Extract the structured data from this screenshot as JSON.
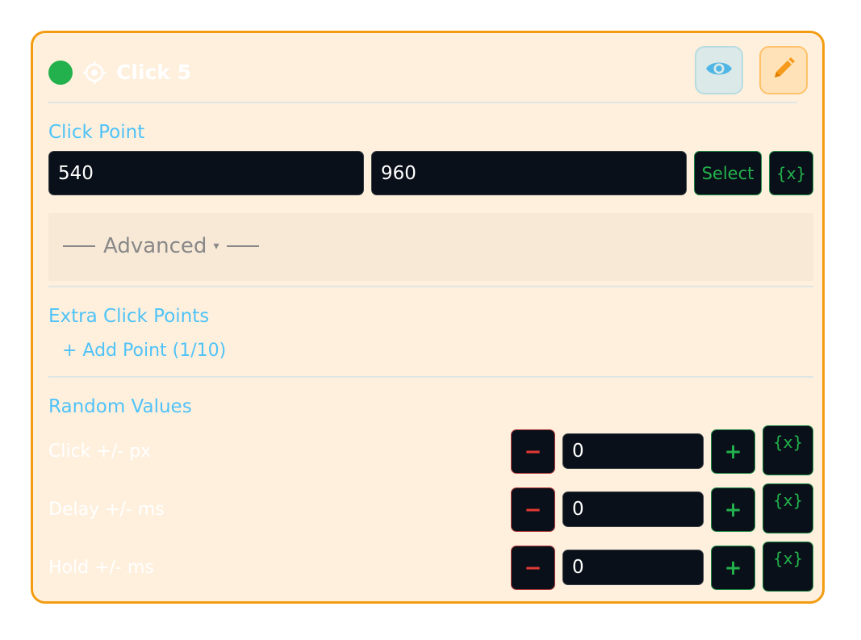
{
  "header": {
    "title": "Click 5",
    "status_color": "#22b14c",
    "eye_icon": "eye-icon",
    "edit_icon": "pencil-icon"
  },
  "click_point": {
    "label": "Click Point",
    "x_value": "540",
    "y_value": "960",
    "select_label": "Select",
    "variable_label": "{x}"
  },
  "advanced": {
    "label": "Advanced",
    "caret": "▾"
  },
  "extra_points": {
    "label": "Extra Click Points",
    "add_label": "+ Add Point (1/10)"
  },
  "random_values": {
    "label": "Random Values",
    "rows": [
      {
        "label": "Click +/- px",
        "value": "0",
        "minus": "−",
        "plus": "+",
        "variable": "{x}"
      },
      {
        "label": "Delay +/- ms",
        "value": "0",
        "minus": "−",
        "plus": "+",
        "variable": "{x}"
      },
      {
        "label": "Hold +/- ms",
        "value": "0",
        "minus": "−",
        "plus": "+",
        "variable": "{x}"
      }
    ]
  },
  "colors": {
    "accent_border": "#f39c12",
    "card_background": "#fff0de",
    "section_label": "#4fc3f7",
    "field_background": "#0a1019"
  }
}
